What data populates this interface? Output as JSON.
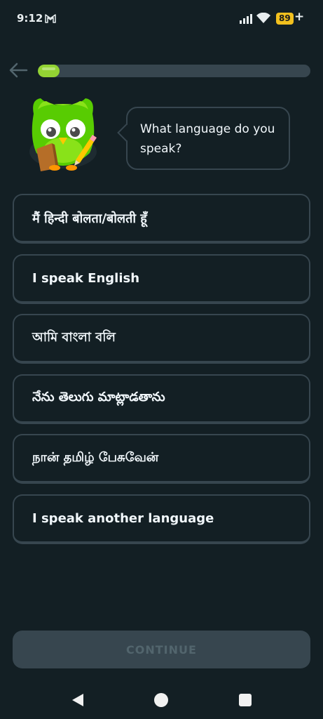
{
  "status_bar": {
    "time": "9:12",
    "battery": "89",
    "battery_suffix": "+"
  },
  "progress": {
    "fraction": 0.08,
    "color": "#93d333"
  },
  "prompt": {
    "text": "What language do you speak?"
  },
  "options": [
    {
      "label": "मैं हिन्दी बोलता/बोलती हूँ"
    },
    {
      "label": "I speak English"
    },
    {
      "label": "আমি বাংলা বলি"
    },
    {
      "label": "నేను తెలుగు మాట్లాడతాను"
    },
    {
      "label": "நான் தமிழ் பேசுவேன்"
    },
    {
      "label": "I speak another language"
    }
  ],
  "footer": {
    "continue_label": "CONTINUE"
  },
  "colors": {
    "background": "#131f24",
    "border": "#37464f",
    "accent_green": "#58cc02"
  }
}
